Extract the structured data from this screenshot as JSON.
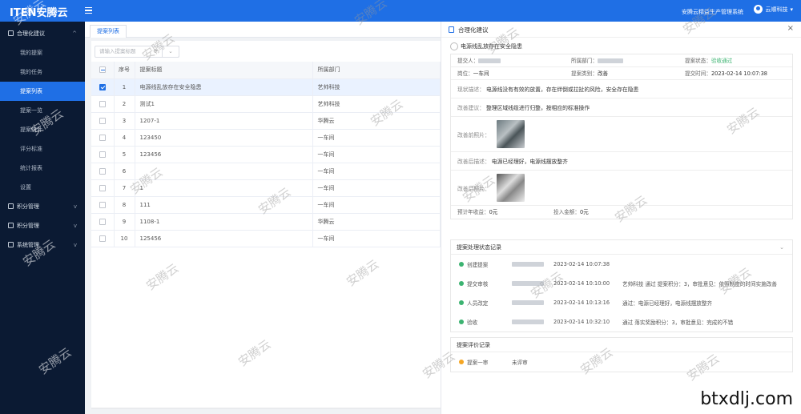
{
  "header": {
    "logo": "ITEN安腾云",
    "system_name": "安腾云精益生产管理系统",
    "user_name": "云顺科技"
  },
  "sidebar": {
    "groups": [
      {
        "label": "合理化建议",
        "expanded": true,
        "items": [
          {
            "label": "我的提案",
            "active": false
          },
          {
            "label": "我的任务",
            "active": false
          },
          {
            "label": "提案列表",
            "active": true
          },
          {
            "label": "提案一览",
            "active": false
          },
          {
            "label": "提案统计",
            "active": false
          },
          {
            "label": "评分标准",
            "active": false
          },
          {
            "label": "统计报表",
            "active": false
          },
          {
            "label": "设置",
            "active": false
          }
        ]
      },
      {
        "label": "积分管理",
        "expanded": false
      },
      {
        "label": "积分管理",
        "expanded": false
      },
      {
        "label": "系统管理",
        "expanded": false
      }
    ]
  },
  "tabs": [
    {
      "label": "提案列表"
    }
  ],
  "list": {
    "search_placeholder": "请输入提案标题",
    "columns": [
      "序号",
      "提案标题",
      "所属部门"
    ],
    "rows": [
      {
        "idx": "1",
        "title": "电源线乱放存在安全隐患",
        "dept": "艺帅科技",
        "checked": true
      },
      {
        "idx": "2",
        "title": "测试1",
        "dept": "艺帅科技",
        "checked": false
      },
      {
        "idx": "3",
        "title": "1207-1",
        "dept": "华腾云",
        "checked": false
      },
      {
        "idx": "4",
        "title": "123450",
        "dept": "一车间",
        "checked": false
      },
      {
        "idx": "5",
        "title": "123456",
        "dept": "一车间",
        "checked": false
      },
      {
        "idx": "6",
        "title": "",
        "dept": "一车间",
        "checked": false
      },
      {
        "idx": "7",
        "title": "1",
        "dept": "一车间",
        "checked": false
      },
      {
        "idx": "8",
        "title": "111",
        "dept": "一车间",
        "checked": false
      },
      {
        "idx": "9",
        "title": "1108-1",
        "dept": "华腾云",
        "checked": false
      },
      {
        "idx": "10",
        "title": "125456",
        "dept": "一车间",
        "checked": false
      }
    ]
  },
  "drawer": {
    "title": "合理化建议",
    "subtitle": "电源线乱放存在安全隐患",
    "info": {
      "r1": {
        "proposer_label": "提交人：",
        "dept_label": "所属部门：",
        "status_label": "提案状态：",
        "status_value": "验收通过"
      },
      "r2": {
        "role_label": "岗位：",
        "role_value": "一车间",
        "type_label": "提案类别：",
        "type_value": "改善",
        "time_label": "提交时间：",
        "time_value": "2023-02-14 10:07:38"
      }
    },
    "status_text_label": "现状描述：",
    "status_text": "电源线没有有效的放置，存在绊倒或拉扯的风险，安全存在隐患",
    "plan_label": "改善建议：",
    "plan_text": "整理区域线缆进行归整，按相应的标准操作",
    "before_photo_label": "改善前照片：",
    "after_text_label": "改善后描述：",
    "after_text": "电源已经理好，电源线摆放整齐",
    "after_photo_label": "改善后照片：",
    "benefit_label": "预计年收益：",
    "benefit_value": "0元",
    "invest_label": "投入金额：",
    "invest_value": "0元",
    "process_title": "提案处理状态记录",
    "logs": [
      {
        "step": "创建提案",
        "time": "2023-02-14 10:07:38",
        "note": ""
      },
      {
        "step": "提交审核",
        "time": "2023-02-14 10:10:00",
        "note": "艺帅科技  通过  提案积分：3，审批意见：依照制度的时间实施改善"
      },
      {
        "step": "人员改定",
        "time": "2023-02-14 10:13:16",
        "note": "通过：电源已经理好，电源线摆放整齐"
      },
      {
        "step": "验收",
        "time": "2023-02-14 10:32:10",
        "note": "通过  落实奖励积分：3，审批意见：完成的不错"
      }
    ],
    "eval_title": "提案评价记录",
    "eval_row": {
      "step": "提案一审",
      "status": "未评审"
    }
  },
  "watermark_text": "安腾云",
  "site_mark": "btxdlj.com"
}
